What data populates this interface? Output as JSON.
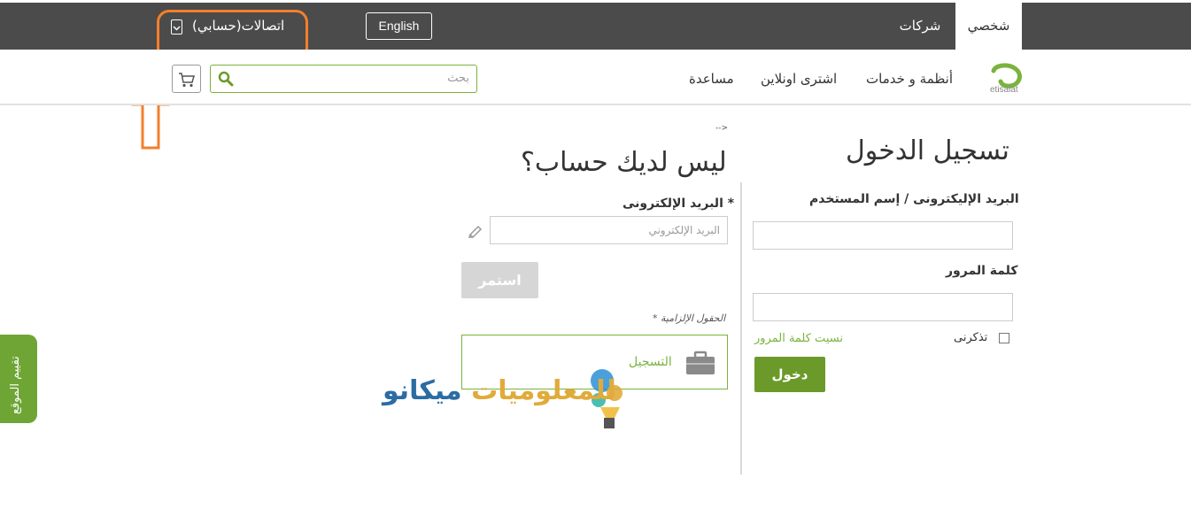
{
  "topbar": {
    "tab_personal": "شخصي",
    "tab_business": "شركات",
    "language_button": "English",
    "account_label": "اتصالات(حسابي)"
  },
  "navbar": {
    "logo_text": "etisalat",
    "systems_services": "أنظمة و خدمات",
    "buy_online": "اشترى اونلاين",
    "help": "مساعدة",
    "search_placeholder": "بحث"
  },
  "login": {
    "title": "تسجيل الدخول",
    "username_label": "البريد الإليكترونى / إسم المستخدم",
    "password_label": "كلمة المرور",
    "remember_me": "تذكرنى",
    "forgot_password": "نسيت كلمة المرور",
    "login_button": "دخول"
  },
  "signup": {
    "back_link": "-->",
    "title": "ليس لديك حساب؟",
    "email_label": "البريد الإلكترونى *",
    "email_placeholder": "البريد الإلكتروني",
    "continue_button": "استمر",
    "required_note": "* الحقول الإلزامية",
    "register_text": "التسجيل"
  },
  "watermark": {
    "part1": "ميكانو",
    "part2": "للمعلوميات"
  },
  "feedback": {
    "label": "تقييم الموقع"
  },
  "colors": {
    "topbar": "#4b4b4b",
    "accent_green": "#6b9a2b",
    "annotation_orange": "#f47f2b"
  }
}
